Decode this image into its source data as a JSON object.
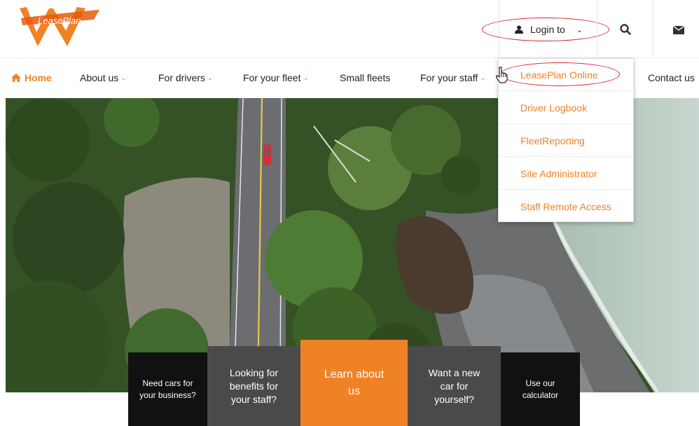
{
  "brand": {
    "logo_text": "LeasePlan",
    "accent": "#f08226",
    "dark": "#111111",
    "grey": "#4a4a4a"
  },
  "header": {
    "login_label": "Login to",
    "icons": [
      "user-icon",
      "chevron-down-icon",
      "search-icon",
      "mail-icon"
    ]
  },
  "nav": {
    "home": "Home",
    "items": [
      {
        "label": "About us",
        "has_dropdown": true
      },
      {
        "label": "For drivers",
        "has_dropdown": true
      },
      {
        "label": "For your fleet",
        "has_dropdown": true
      },
      {
        "label": "Small fleets",
        "has_dropdown": false
      },
      {
        "label": "For your staff",
        "has_dropdown": true
      },
      {
        "label": "Contact us",
        "has_dropdown": false
      }
    ]
  },
  "login_menu": {
    "items": [
      "LeasePlan Online",
      "Driver Logbook",
      "FleetReporting",
      "Site Administrator",
      "Staff Remote Access"
    ]
  },
  "tiles": [
    {
      "label": "Need cars for your business?"
    },
    {
      "label": "Looking for benefits for your staff?"
    },
    {
      "label": "Learn about us"
    },
    {
      "label": "Want a new car for yourself?"
    },
    {
      "label": "Use our calculator"
    }
  ]
}
